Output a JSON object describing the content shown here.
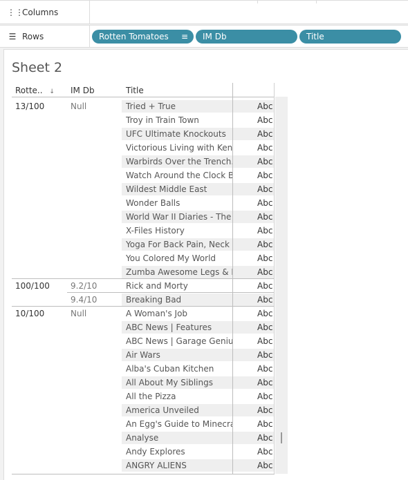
{
  "shelves": {
    "columns_label": "Columns",
    "rows_label": "Rows",
    "row_pills": [
      "Rotten Tomatoes",
      "IM Db",
      "Title"
    ]
  },
  "sheet": {
    "title": "Sheet 2",
    "headers": {
      "rotten": "Rotte..",
      "imdb": "IM Db",
      "title": "Title"
    },
    "abc": "Abc",
    "groups": [
      {
        "rotten": "13/100",
        "subgroups": [
          {
            "imdb": "Null",
            "titles": [
              "Tried + True",
              "Troy in Train Town",
              "UFC Ultimate Knockouts",
              "Victorious Living with Ken..",
              "Warbirds Over the Trench..",
              "Watch Around the Clock B..",
              "Wildest Middle East",
              "Wonder Balls",
              "World War II Diaries - The ..",
              "X-Files History",
              "Yoga For Back Pain, Neck ..",
              "You Colored My World",
              "Zumba Awesome Legs & B.."
            ]
          }
        ]
      },
      {
        "rotten": "100/100",
        "subgroups": [
          {
            "imdb": "9.2/10",
            "titles": [
              "Rick and Morty"
            ]
          },
          {
            "imdb": "9.4/10",
            "titles": [
              "Breaking Bad"
            ]
          }
        ]
      },
      {
        "rotten": "10/100",
        "subgroups": [
          {
            "imdb": "Null",
            "titles": [
              "A Woman's Job",
              "ABC News | Features",
              "ABC News | Garage Geniu..",
              "Air Wars",
              "Alba's Cuban Kitchen",
              "All About My Siblings",
              "All the Pizza",
              "America Unveiled",
              "An Egg's Guide to Minecra..",
              "Analyse",
              "Andy Explores",
              "ANGRY ALIENS"
            ]
          }
        ]
      }
    ]
  }
}
